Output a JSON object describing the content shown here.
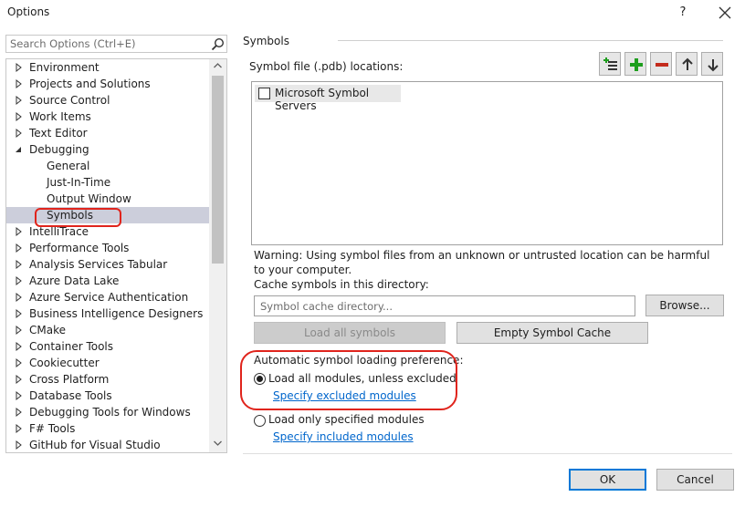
{
  "window": {
    "title": "Options",
    "help_label": "?",
    "close_label": "✕"
  },
  "search": {
    "placeholder": "Search Options (Ctrl+E)"
  },
  "tree": {
    "items": [
      {
        "label": "Environment",
        "arrow": "collapsed"
      },
      {
        "label": "Projects and Solutions",
        "arrow": "collapsed"
      },
      {
        "label": "Source Control",
        "arrow": "collapsed"
      },
      {
        "label": "Work Items",
        "arrow": "collapsed"
      },
      {
        "label": "Text Editor",
        "arrow": "collapsed"
      },
      {
        "label": "Debugging",
        "arrow": "expanded"
      },
      {
        "label": "General",
        "arrow": "none"
      },
      {
        "label": "Just-In-Time",
        "arrow": "none"
      },
      {
        "label": "Output Window",
        "arrow": "none"
      },
      {
        "label": "Symbols",
        "arrow": "none",
        "selected": true
      },
      {
        "label": "IntelliTrace",
        "arrow": "collapsed"
      },
      {
        "label": "Performance Tools",
        "arrow": "collapsed"
      },
      {
        "label": "Analysis Services Tabular",
        "arrow": "collapsed"
      },
      {
        "label": "Azure Data Lake",
        "arrow": "collapsed"
      },
      {
        "label": "Azure Service Authentication",
        "arrow": "collapsed"
      },
      {
        "label": "Business Intelligence Designers",
        "arrow": "collapsed"
      },
      {
        "label": "CMake",
        "arrow": "collapsed"
      },
      {
        "label": "Container Tools",
        "arrow": "collapsed"
      },
      {
        "label": "Cookiecutter",
        "arrow": "collapsed"
      },
      {
        "label": "Cross Platform",
        "arrow": "collapsed"
      },
      {
        "label": "Database Tools",
        "arrow": "collapsed"
      },
      {
        "label": "Debugging Tools for Windows",
        "arrow": "collapsed"
      },
      {
        "label": "F# Tools",
        "arrow": "collapsed"
      },
      {
        "label": "GitHub for Visual Studio",
        "arrow": "collapsed"
      }
    ]
  },
  "symbols": {
    "section_title": "Symbols",
    "locations_label": "Symbol file (.pdb) locations:",
    "toolbar_icons": [
      "add-location-icon",
      "plus-icon",
      "minus-icon",
      "arrow-up-icon",
      "arrow-down-icon"
    ],
    "locations": [
      {
        "label": "Microsoft Symbol Servers",
        "checked": false
      }
    ],
    "warning": "Warning: Using symbol files from an unknown or untrusted location can be harmful to your computer.",
    "cache_label": "Cache symbols in this directory:",
    "cache_placeholder": "Symbol cache directory...",
    "browse_label": "Browse...",
    "load_all_label": "Load all symbols",
    "empty_cache_label": "Empty Symbol Cache",
    "pref_label": "Automatic symbol loading preference:",
    "option_all_label": "Load all modules, unless excluded",
    "option_all_selected": true,
    "excluded_link": "Specify excluded modules",
    "option_specified_label": "Load only specified modules",
    "option_specified_selected": false,
    "included_link": "Specify included modules"
  },
  "footer": {
    "ok_label": "OK",
    "cancel_label": "Cancel"
  },
  "colors": {
    "selection": "#cccedb",
    "highlight_ring": "#e0241c",
    "link": "#0066cc",
    "default_button_border": "#0078d7",
    "plus_green": "#1e9e1e",
    "minus_red": "#c42b1c"
  }
}
